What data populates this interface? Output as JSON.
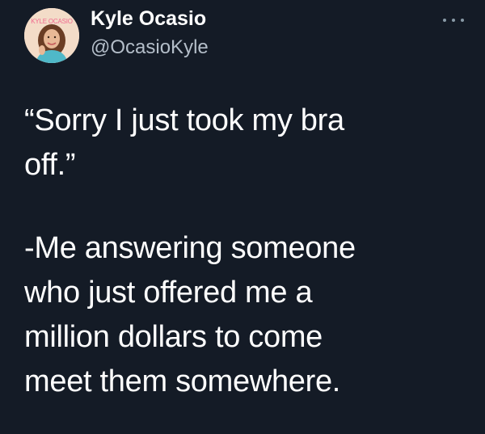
{
  "tweet": {
    "author": {
      "display_name": "Kyle Ocasio",
      "handle": "@OcasioKyle",
      "avatar_wordmark": "KYLE OCASIO"
    },
    "menu_icon": "more-horizontal-icon",
    "paragraphs": [
      {
        "lines": [
          "“Sorry I just took my bra",
          "off.”"
        ]
      },
      {
        "lines": [
          "-Me answering someone",
          "who just offered me a",
          "million dollars to come",
          "meet them somewhere."
        ]
      }
    ]
  },
  "colors": {
    "background": "#141b26",
    "text": "#ffffff",
    "handle": "#b4bec9",
    "icon": "#8899a6"
  }
}
